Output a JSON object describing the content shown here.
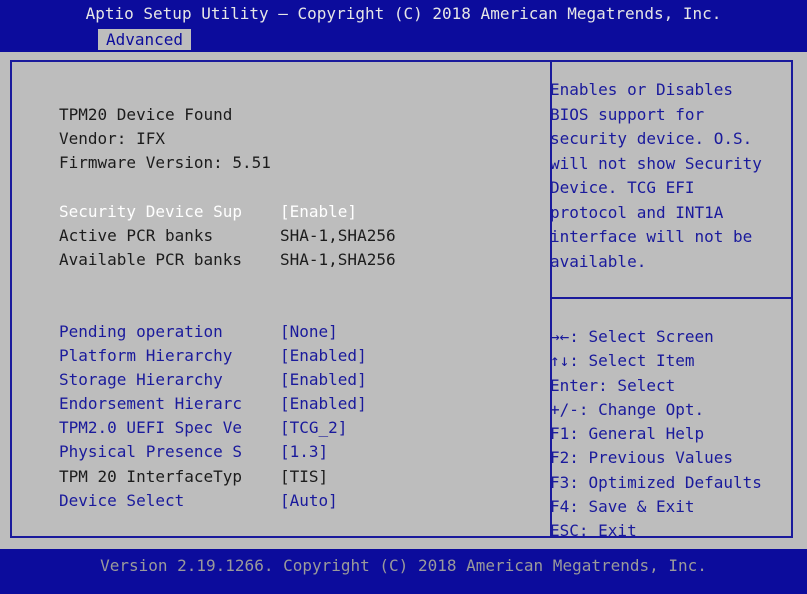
{
  "header": {
    "title": "Aptio Setup Utility – Copyright (C) 2018 American Megatrends, Inc.",
    "active_tab": "Advanced"
  },
  "info": {
    "device_found": "TPM20 Device Found",
    "vendor": "Vendor: IFX",
    "firmware": "Firmware Version: 5.51"
  },
  "security_device": {
    "label": "Security Device Sup",
    "value": "[Enable]"
  },
  "pcr": {
    "active_label": "Active PCR banks",
    "active_value": "SHA-1,SHA256",
    "available_label": "Available PCR banks",
    "available_value": "SHA-1,SHA256"
  },
  "settings": [
    {
      "label": "Pending operation",
      "value": "[None]"
    },
    {
      "label": "Platform Hierarchy",
      "value": "[Enabled]"
    },
    {
      "label": "Storage Hierarchy",
      "value": "[Enabled]"
    },
    {
      "label": "Endorsement Hierarc",
      "value": "[Enabled]"
    },
    {
      "label": "TPM2.0 UEFI Spec Ve",
      "value": "[TCG_2]"
    },
    {
      "label": "Physical Presence S",
      "value": "[1.3]"
    },
    {
      "label": "TPM 20 InterfaceTyp",
      "value": "[TIS]"
    },
    {
      "label": "Device Select",
      "value": "[Auto]"
    }
  ],
  "help_text": "Enables or Disables\nBIOS support for\nsecurity device. O.S.\nwill not show Security\nDevice. TCG EFI\nprotocol and INT1A\ninterface will not be\navailable.",
  "key_help": [
    "→←: Select Screen",
    "↑↓: Select Item",
    "Enter: Select",
    "+/-: Change Opt.",
    "F1: General Help",
    "F2: Previous Values",
    "F3: Optimized Defaults",
    "F4: Save & Exit",
    "ESC: Exit"
  ],
  "footer": "Version 2.19.1266. Copyright (C) 2018 American Megatrends, Inc.",
  "colors": {
    "background_blue": "#0c0c9c",
    "panel_gray": "#bdbdbd",
    "highlight_white": "#ffffff"
  }
}
